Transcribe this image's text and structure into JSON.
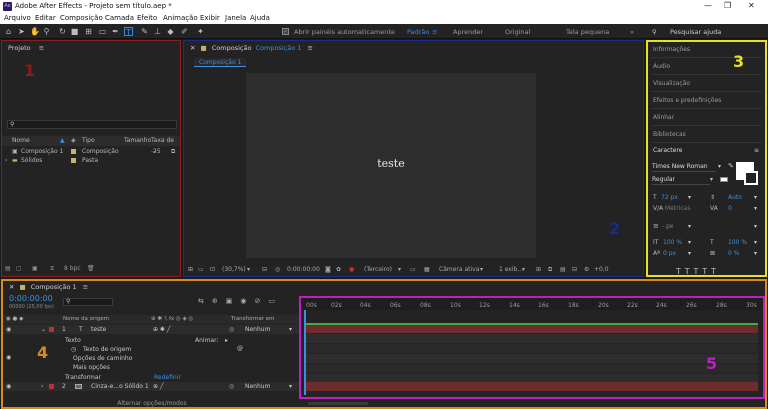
{
  "window": {
    "title": "Adobe After Effects - Projeto sem título.aep *",
    "app_badge": "Ae",
    "controls": [
      "—",
      "❐",
      "✕"
    ]
  },
  "menu": [
    "Arquivo",
    "Editar",
    "Composição",
    "Camada",
    "Efeito",
    "Animação",
    "Exibir",
    "Janela",
    "Ajuda"
  ],
  "toolbar": {
    "auto_open": "Abrir painéis automaticamente",
    "workspaces": [
      "Padrão",
      "Aprender",
      "Original",
      "Tela pequena"
    ],
    "active_workspace": "Padrão",
    "search_placeholder": "Pesquisar ajuda"
  },
  "project": {
    "title": "Projeto",
    "columns": [
      "Nome",
      "Tipo",
      "Tamanho",
      "Taxa de ..."
    ],
    "items": [
      {
        "name": "Composição 1",
        "type": "Composição",
        "size": "25",
        "color": "#c9b36a"
      },
      {
        "name": "Sólidos",
        "type": "Pasta",
        "size": "",
        "color": "#c9b36a"
      }
    ],
    "bpc": "8 bpc",
    "label_num": "1"
  },
  "composition": {
    "title": "Composição",
    "title_link": "Composição 1",
    "tab": "Composição 1",
    "canvas_text": "teste",
    "zoom": "(30,7%)",
    "time": "0:00:00:00",
    "quality": "(Terceiro)",
    "camera": "Câmera ativa",
    "views": "1 exib...",
    "offset": "+0,0",
    "label_num": "2"
  },
  "right_panels": {
    "items": [
      "Informações",
      "Áudio",
      "Visualização",
      "Efeitos e predefinições",
      "Alinhar",
      "Bibliotecas"
    ],
    "character": {
      "title": "Caractere",
      "font": "Times New Roman",
      "style": "Regular",
      "size": "72 px",
      "leading": "Auto",
      "kerning": "Métricas",
      "tracking": "0",
      "stroke": "- px",
      "vscale": "100 %",
      "hscale": "100 %",
      "baseline": "0 px",
      "tsume": "0 %"
    },
    "label_num": "3"
  },
  "timeline": {
    "title": "Composição 1",
    "timecode": "0:00:00:00",
    "frame_info": "00000 (25,00 fps)",
    "col_name": "Nome da origem",
    "col_transform": "Transformar em principal...",
    "label_num": "4",
    "ruler_label_num": "5",
    "ticks": [
      "00s",
      "02s",
      "04s",
      "06s",
      "08s",
      "10s",
      "12s",
      "14s",
      "16s",
      "18s",
      "20s",
      "22s",
      "24s",
      "26s",
      "28s",
      "30s"
    ],
    "layers": [
      {
        "num": "1",
        "type": "T",
        "name": "teste",
        "parent": "Nenhum"
      },
      {
        "num": "2",
        "type": "",
        "name": "Cinza-e...o Sólido 1",
        "parent": "Nenhum"
      }
    ],
    "props": {
      "texto": "Texto",
      "animar": "Animar:",
      "origem": "Texto de origem",
      "caminho": "Opções de caminho",
      "mais": "Mais opções",
      "transformar": "Transformar",
      "redefinir": "Redefinir"
    },
    "footer": "Alternar opções/modos"
  }
}
